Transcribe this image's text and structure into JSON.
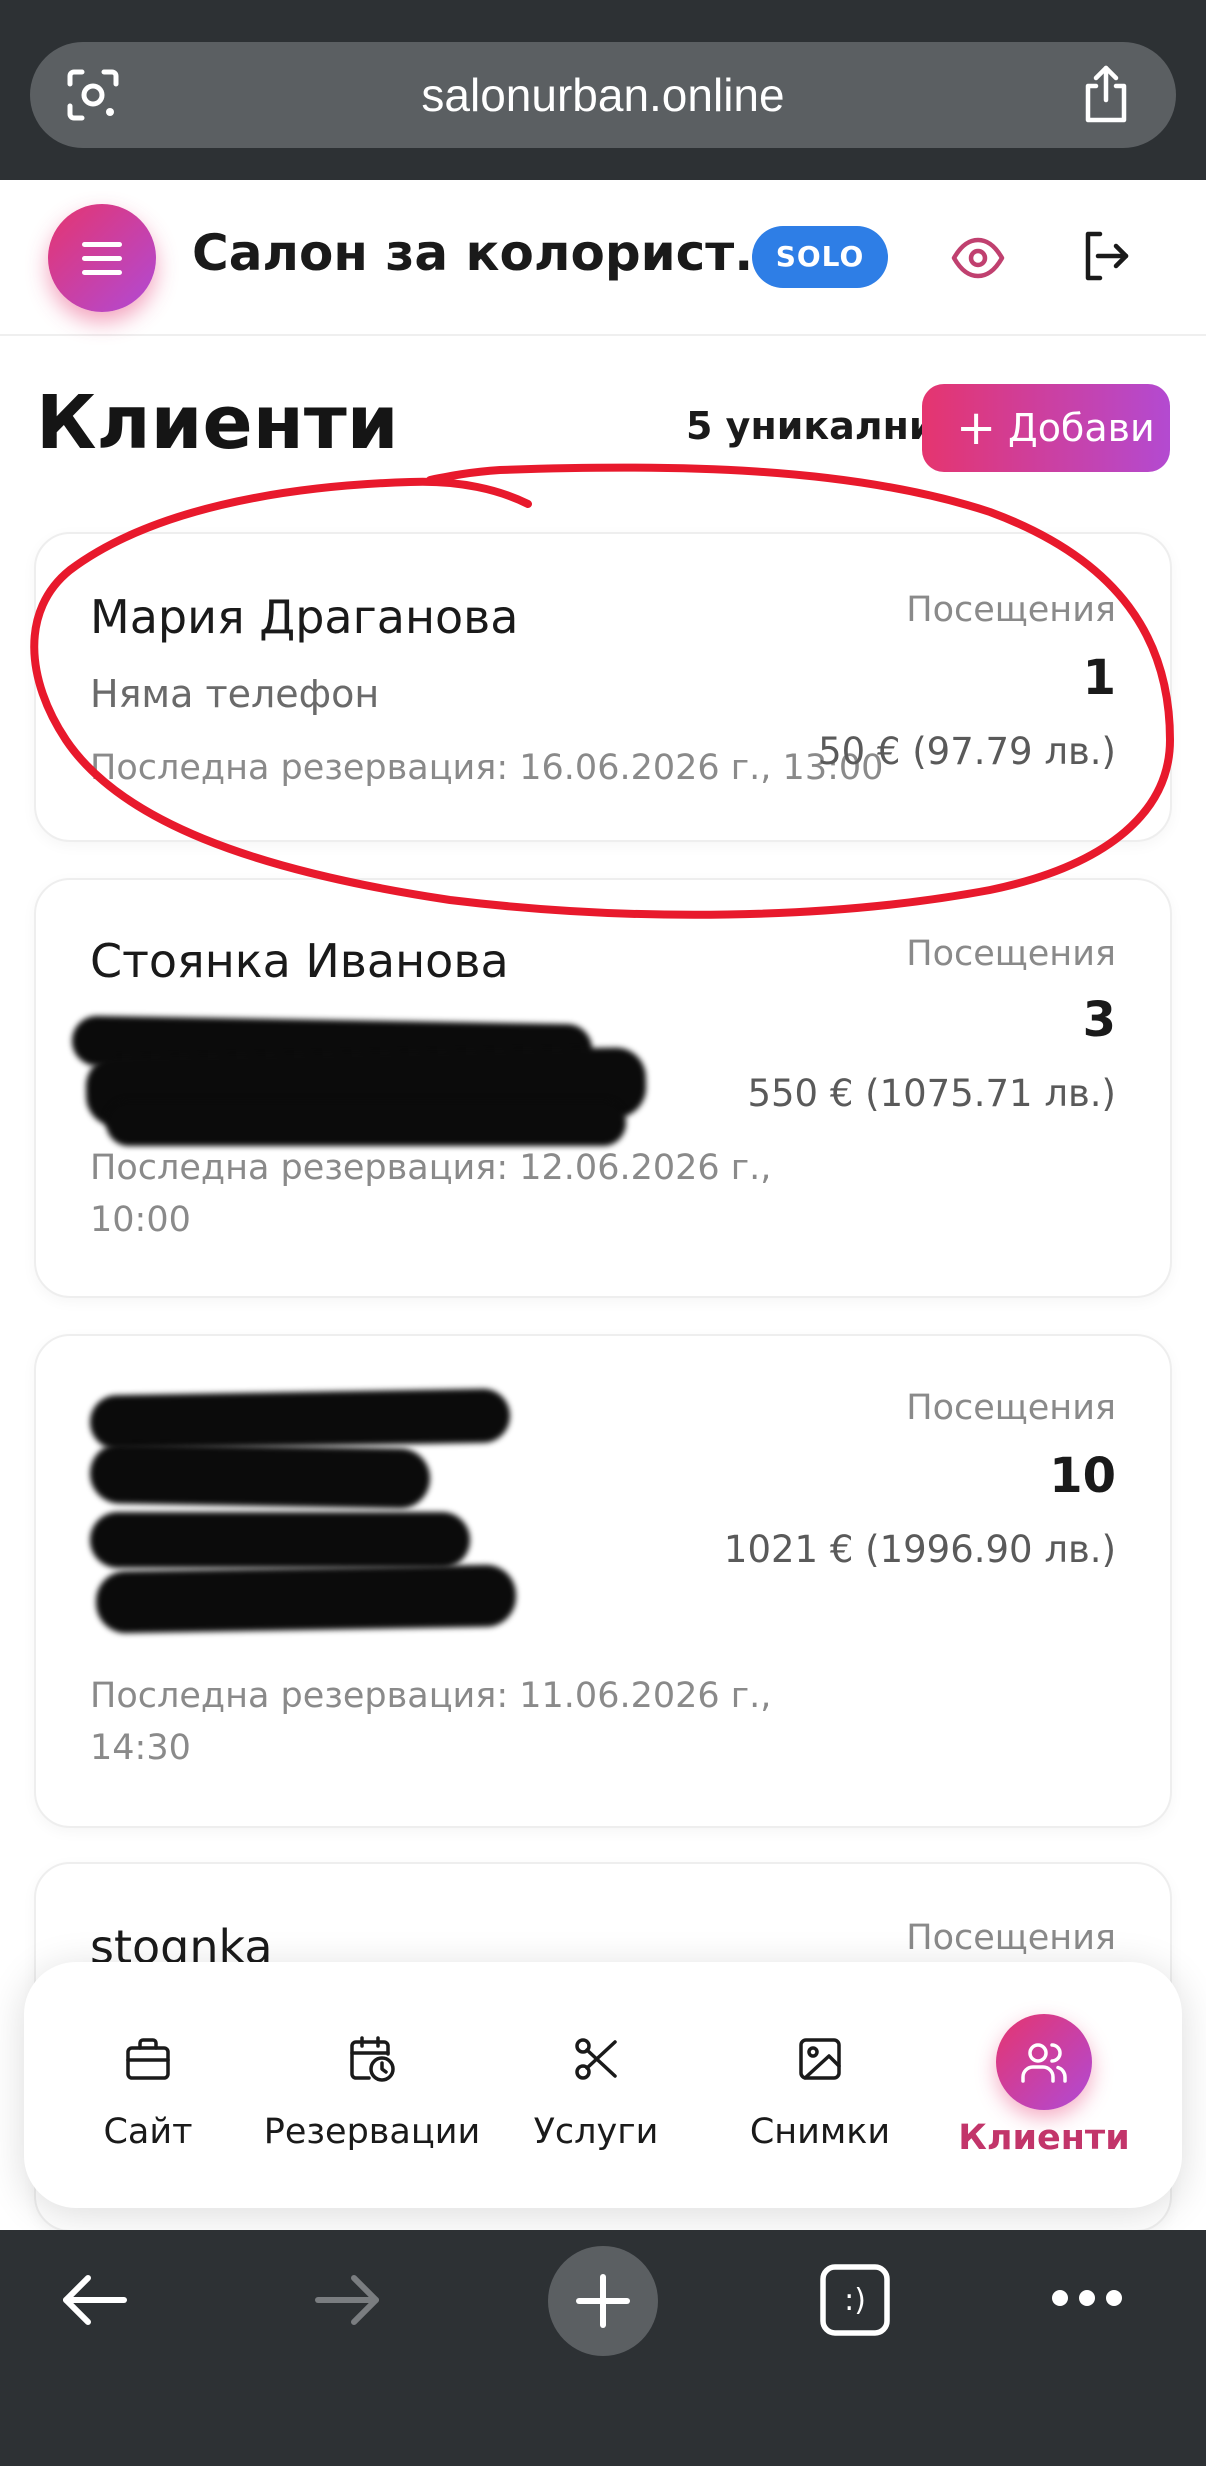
{
  "browser": {
    "url": "salonurban.online"
  },
  "header": {
    "title": "Салон за колорист...",
    "plan_badge": "SOLO"
  },
  "page": {
    "title": "Клиенти",
    "unique_count": "5 уникални",
    "add_button": "Добави",
    "add_button_icon": "plus-icon"
  },
  "clients": [
    {
      "name": "Мария Драганова",
      "phone": "Няма телефон",
      "last_booking": "Последна резервация: 16.06.2026 г., 13:00",
      "visits_label": "Посещения",
      "visits": "1",
      "amount": "50 € (97.79 лв.)"
    },
    {
      "name": "Стоянка Иванова",
      "last_booking_line1": "Последна резервация: 12.06.2026 г.,",
      "last_booking_line2": "10:00",
      "visits_label": "Посещения",
      "visits": "3",
      "amount": "550 € (1075.71 лв.)"
    },
    {
      "last_booking_line1": "Последна резервация: 11.06.2026 г.,",
      "last_booking_line2": "14:30",
      "visits_label": "Посещения",
      "visits": "10",
      "amount": "1021 € (1996.90 лв.)"
    },
    {
      "name": "stoqnka",
      "visits_label": "Посещения"
    }
  ],
  "bottom_nav": {
    "items": [
      {
        "label": "Сайт",
        "icon": "briefcase-icon"
      },
      {
        "label": "Резервации",
        "icon": "calendar-clock-icon"
      },
      {
        "label": "Услуги",
        "icon": "scissors-icon"
      },
      {
        "label": "Снимки",
        "icon": "image-icon"
      },
      {
        "label": "Клиенти",
        "icon": "users-icon",
        "active": true
      }
    ]
  },
  "colors": {
    "accent": "#e5356f",
    "accent_end": "#b04ad6",
    "badge_blue": "#2e7ee6",
    "annotation_red": "#e8192c",
    "browser_chrome": "#2d3134"
  }
}
